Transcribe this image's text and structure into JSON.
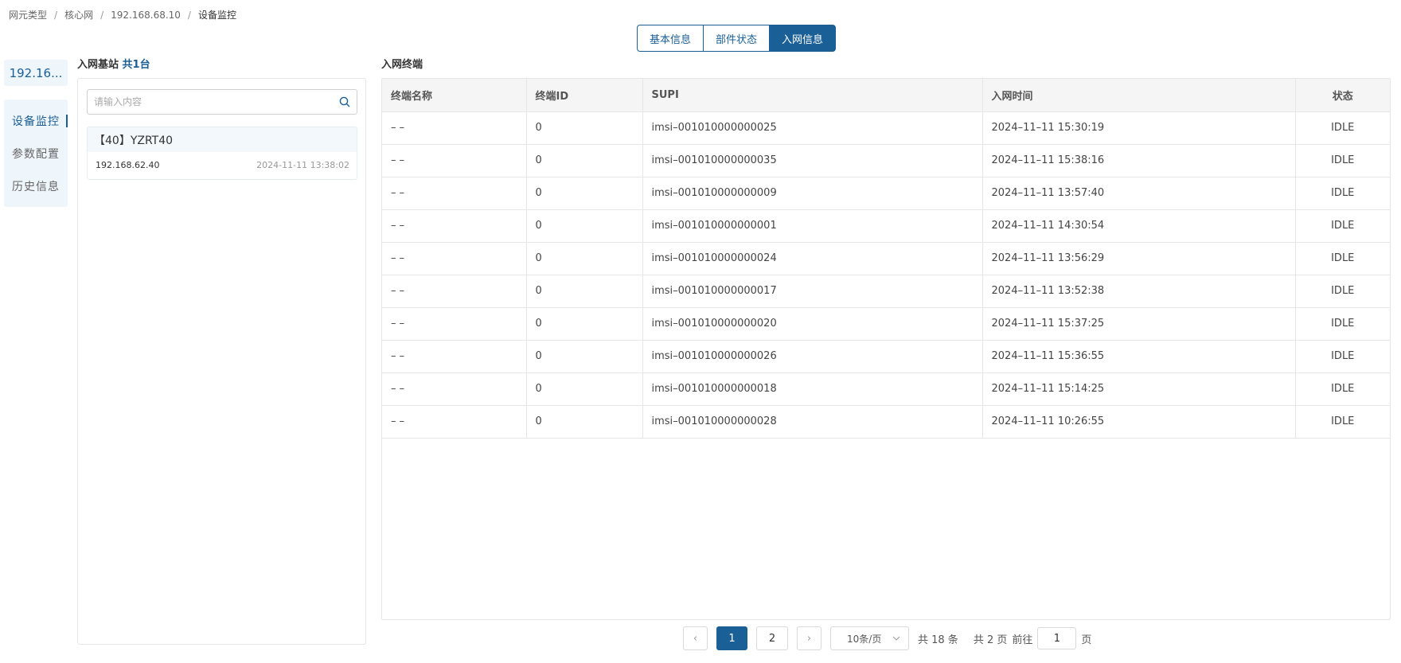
{
  "breadcrumb": [
    "网元类型",
    "核心网",
    "192.168.68.10",
    "设备监控"
  ],
  "tabs": [
    "基本信息",
    "部件状态",
    "入网信息"
  ],
  "device": {
    "ip_short": "192.16..."
  },
  "sidenav": [
    "设备监控",
    "参数配置",
    "历史信息"
  ],
  "stations": {
    "title": "入网基站",
    "count": "共1台",
    "search_placeholder": "请输入内容",
    "items": [
      {
        "name": "【40】YZRT40",
        "ip": "192.168.62.40",
        "time": "2024-11-11 13:38:02"
      }
    ]
  },
  "terminals": {
    "title": "入网终端",
    "columns": [
      "终端名称",
      "终端ID",
      "SUPI",
      "入网时间",
      "状态"
    ],
    "rows": [
      [
        "– –",
        "0",
        "imsi–001010000000025",
        "2024–11–11 15:30:19",
        "IDLE"
      ],
      [
        "– –",
        "0",
        "imsi–001010000000035",
        "2024–11–11 15:38:16",
        "IDLE"
      ],
      [
        "– –",
        "0",
        "imsi–001010000000009",
        "2024–11–11 13:57:40",
        "IDLE"
      ],
      [
        "– –",
        "0",
        "imsi–001010000000001",
        "2024–11–11 14:30:54",
        "IDLE"
      ],
      [
        "– –",
        "0",
        "imsi–001010000000024",
        "2024–11–11 13:56:29",
        "IDLE"
      ],
      [
        "– –",
        "0",
        "imsi–001010000000017",
        "2024–11–11 13:52:38",
        "IDLE"
      ],
      [
        "– –",
        "0",
        "imsi–001010000000020",
        "2024–11–11 15:37:25",
        "IDLE"
      ],
      [
        "– –",
        "0",
        "imsi–001010000000026",
        "2024–11–11 15:36:55",
        "IDLE"
      ],
      [
        "– –",
        "0",
        "imsi–001010000000018",
        "2024–11–11 15:14:25",
        "IDLE"
      ],
      [
        "– –",
        "0",
        "imsi–001010000000028",
        "2024–11–11 10:26:55",
        "IDLE"
      ]
    ]
  },
  "pagination": {
    "prev": "‹",
    "next": "›",
    "pages": [
      "1",
      "2"
    ],
    "page_size": "10条/页",
    "total": "共 18 条",
    "total_pages": "共 2 页",
    "goto_label": "前往",
    "goto_value": "1",
    "goto_suffix": "页"
  },
  "colors": {
    "primary": "#1a5f96",
    "sidenav_bg": "#eef5fb"
  }
}
